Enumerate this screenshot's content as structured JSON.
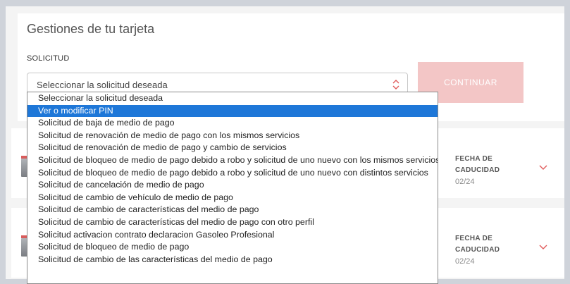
{
  "header": {
    "title": "Gestiones de tu tarjeta"
  },
  "form": {
    "field_label": "SOLICITUD",
    "select_value": "Seleccionar la solicitud deseada",
    "continue_label": "CONTINUAR"
  },
  "dropdown": {
    "selected_index": 1,
    "options": [
      "Seleccionar la solicitud deseada",
      "Ver o modificar PIN",
      "Solicitud de baja de medio de pago",
      "Solicitud de renovación de medio de pago con los mismos servicios",
      "Solicitud de renovación de medio de pago y cambio de servicios",
      "Solicitud de bloqueo de medio de pago debido a robo y solicitud de uno nuevo con los mismos servicios",
      "Solicitud de bloqueo de medio de pago debido a robo y solicitud de uno nuevo con distintos servicios",
      "Solicitud de cancelación de medio de pago",
      "Solicitud de cambio de vehículo de medio de pago",
      "Solicitud de cambio de características del medio de pago",
      "Solicitud de cambio de características del medio de pago con otro perfil",
      "Solicitud activacion contrato declaracion Gasoleo Profesional",
      "Solicitud de bloqueo de medio de pago",
      "Solicitud de cambio de las características del medio de pago"
    ]
  },
  "cards": [
    {
      "expiry_label_line1": "FECHA DE",
      "expiry_label_line2": "CADUCIDAD",
      "expiry_value": "02/24"
    },
    {
      "expiry_label_line1": "FECHA DE",
      "expiry_label_line2": "CADUCIDAD",
      "expiry_value": "02/24"
    }
  ],
  "colors": {
    "accent": "#e05a5a",
    "button_disabled": "#f3c6c6",
    "option_highlight": "#1e77d8"
  },
  "icons": {
    "select": "chevron-updown-icon",
    "card_expand": "chevron-down-icon",
    "card_thumbnail": "card-icon"
  }
}
